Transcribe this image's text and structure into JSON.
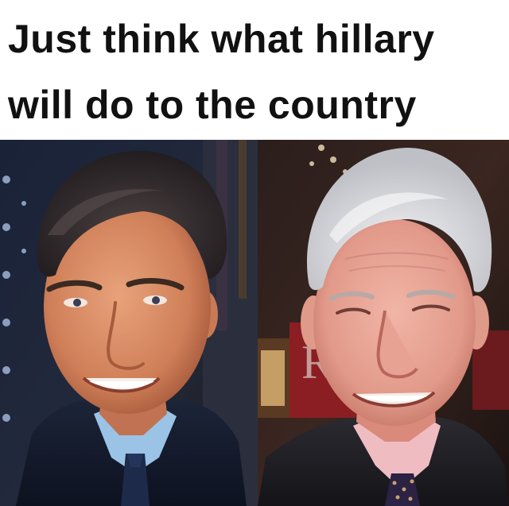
{
  "caption": {
    "line1": "Just think what hillary",
    "line2": "will do to the country"
  },
  "photos": {
    "left": {
      "description_icon": "portrait-younger-man"
    },
    "right": {
      "description_icon": "portrait-older-man"
    }
  },
  "colors": {
    "caption_text": "#111111",
    "caption_bg": "#ffffff"
  }
}
